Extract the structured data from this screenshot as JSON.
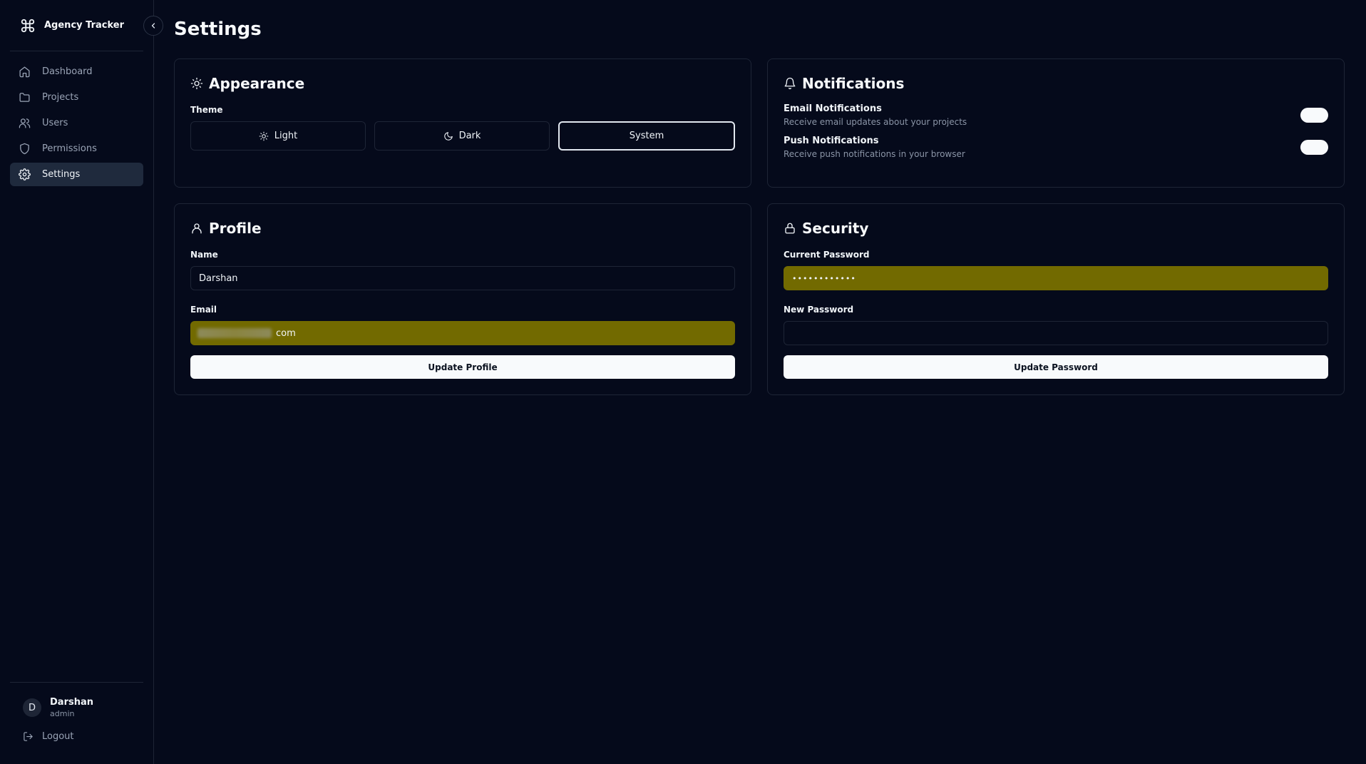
{
  "app": {
    "name": "Agency Tracker"
  },
  "sidebar": {
    "items": [
      {
        "label": "Dashboard",
        "icon": "home-icon"
      },
      {
        "label": "Projects",
        "icon": "folder-icon"
      },
      {
        "label": "Users",
        "icon": "users-icon"
      },
      {
        "label": "Permissions",
        "icon": "shield-icon"
      },
      {
        "label": "Settings",
        "icon": "gear-icon",
        "active": true
      }
    ],
    "user": {
      "initial": "D",
      "name": "Darshan",
      "role": "admin"
    },
    "logout_label": "Logout"
  },
  "page": {
    "title": "Settings"
  },
  "appearance": {
    "title": "Appearance",
    "theme_label": "Theme",
    "options": [
      "Light",
      "Dark",
      "System"
    ],
    "selected": "System"
  },
  "notifications": {
    "title": "Notifications",
    "items": [
      {
        "title": "Email Notifications",
        "description": "Receive email updates about your projects",
        "enabled": true
      },
      {
        "title": "Push Notifications",
        "description": "Receive push notifications in your browser",
        "enabled": true
      }
    ]
  },
  "profile": {
    "title": "Profile",
    "name_label": "Name",
    "name_value": "Darshan",
    "email_label": "Email",
    "email_value_visible": "com",
    "button_label": "Update Profile"
  },
  "security": {
    "title": "Security",
    "current_label": "Current Password",
    "current_value": "••••••••••••",
    "new_label": "New Password",
    "new_value": "",
    "button_label": "Update Password"
  },
  "colors": {
    "background": "#050a1b",
    "border": "#1e2536",
    "active_nav": "#1f2a3d",
    "autofill": "#726a00",
    "primary_button": "#f8fafc"
  }
}
